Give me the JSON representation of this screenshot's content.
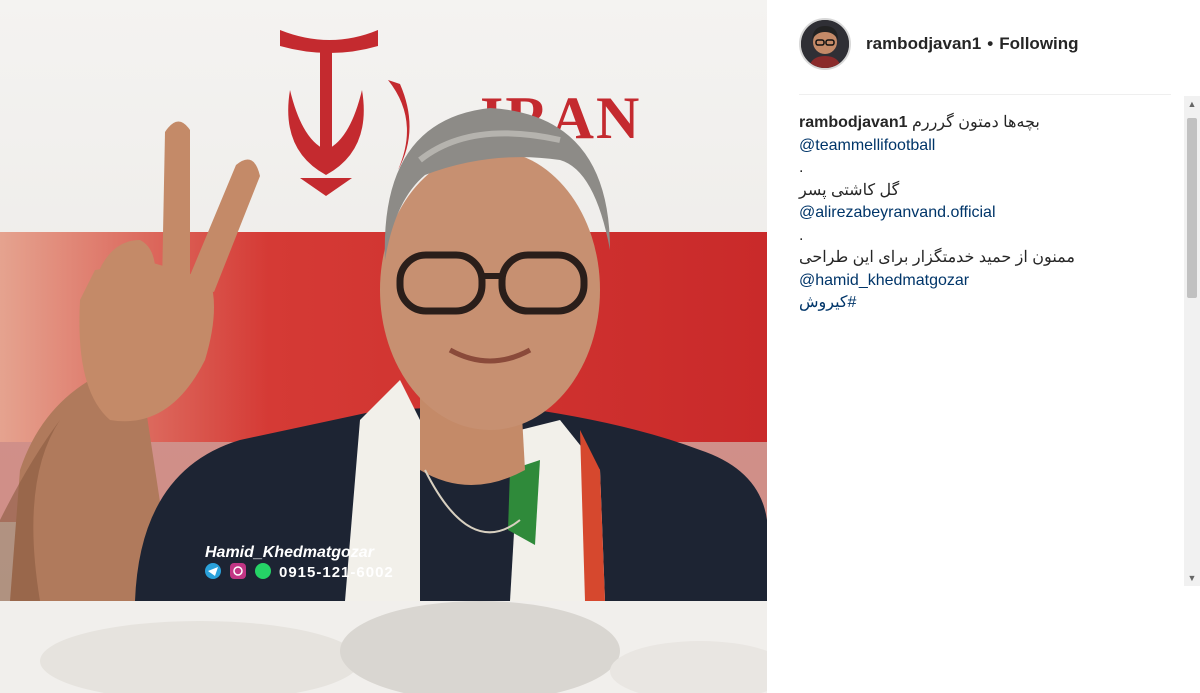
{
  "post": {
    "username": "rambodjavan1",
    "separator": "•",
    "follow_status": "Following"
  },
  "photo": {
    "banner_text": "IRAN",
    "watermark_name": "Hamid_Khedmatgozar",
    "watermark_phone": "0915-121-6002"
  },
  "caption": {
    "author": "rambodjavan1",
    "line1_text": "بچه‌ها دمتون گرررم",
    "mention1": "@teammellifootball",
    "dot1": ".",
    "line2_text": "گل کاشتی پسر",
    "mention2": "@alirezabeyranvand.official",
    "dot2": ".",
    "line3_text": "ممنون از حمید خدمتگزار برای این طراحی",
    "mention3": "@hamid_khedmatgozar",
    "hashtag": "#کیروش"
  },
  "colors": {
    "link": "#003569",
    "text": "#262626",
    "flag_red": "#cf2b2b",
    "flag_green": "#2f8a3a",
    "shirt": "#1d2433"
  }
}
